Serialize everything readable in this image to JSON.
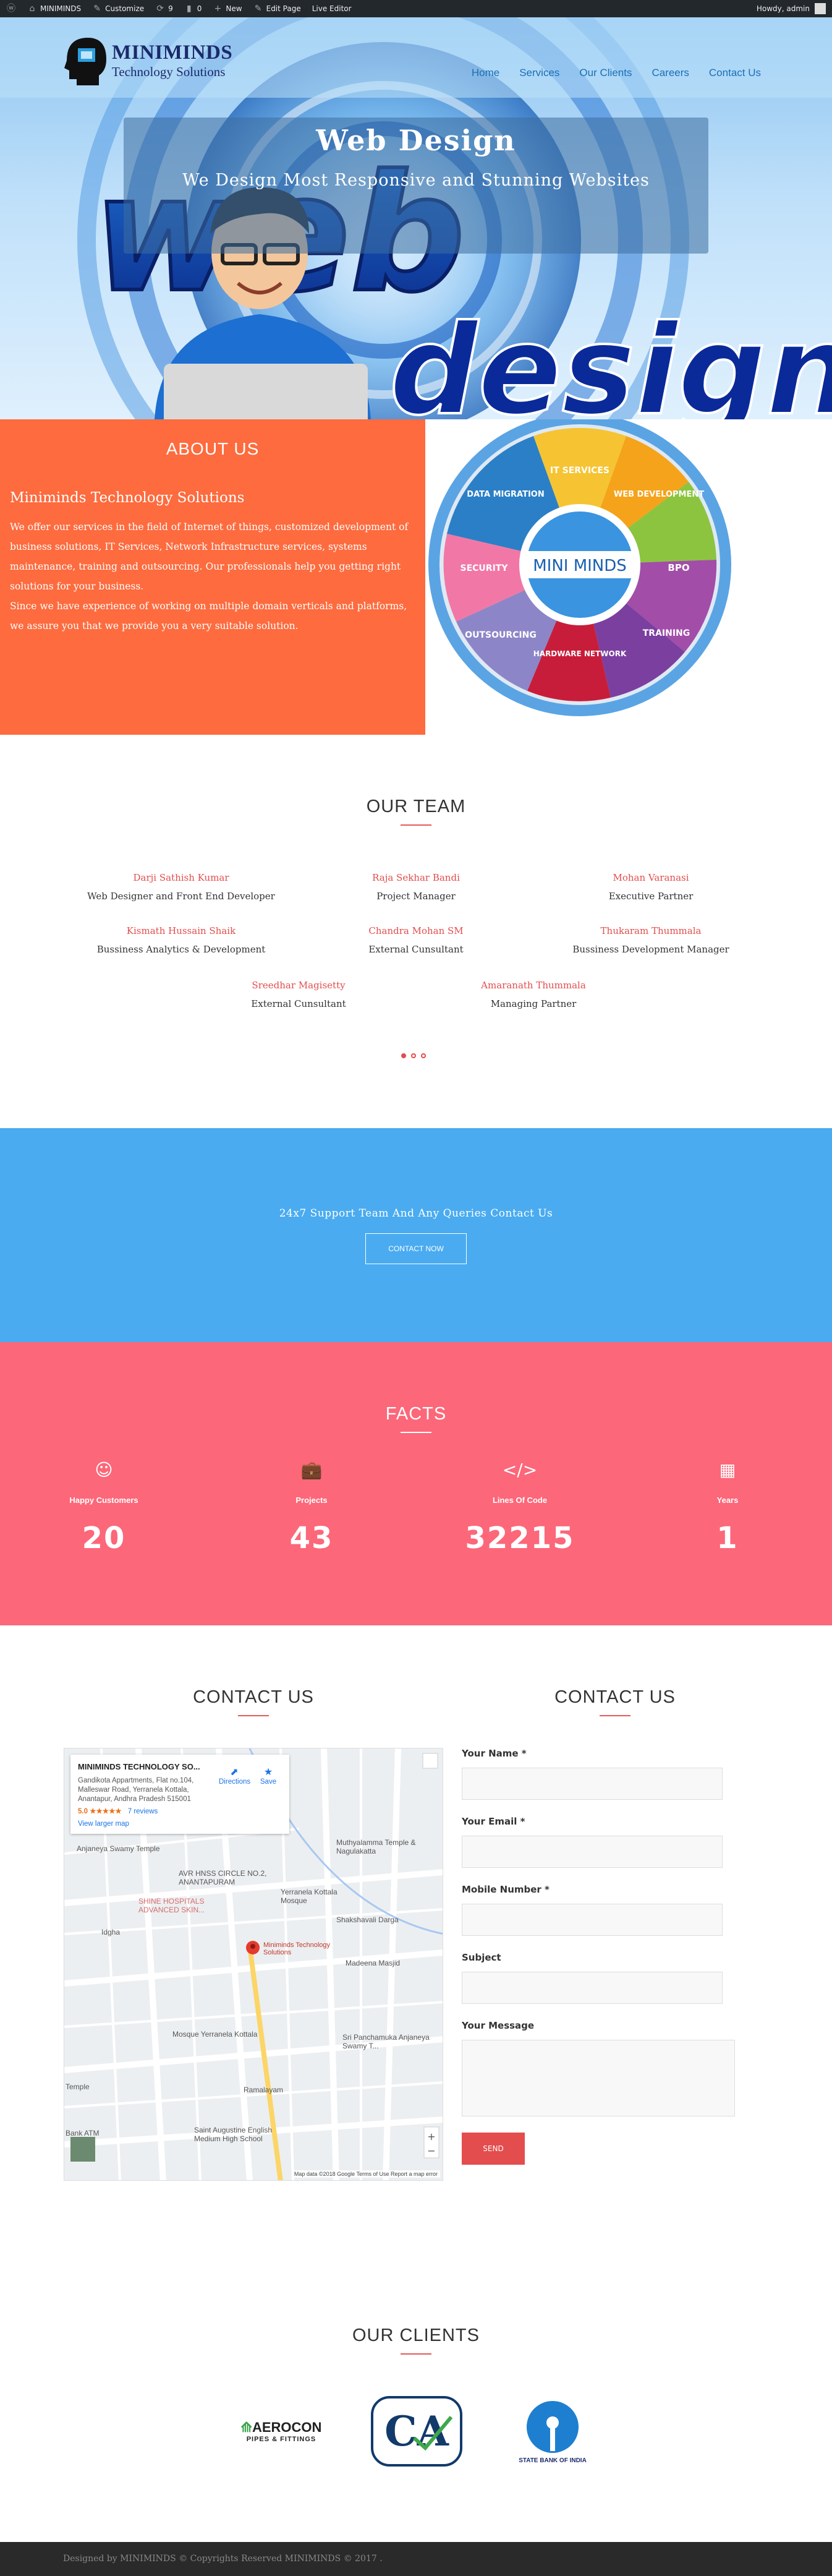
{
  "adminbar": {
    "site_name": "MINIMINDS",
    "customize": "Customize",
    "updates_count": "9",
    "comments_count": "0",
    "new_label": "New",
    "edit_page": "Edit Page",
    "live_editor": "Live Editor",
    "howdy": "Howdy, admin"
  },
  "header": {
    "logo_name": "MINIMINDS",
    "logo_sub": "Technology Solutions",
    "nav": [
      "Home",
      "Services",
      "Our Clients",
      "Careers",
      "Contact Us"
    ]
  },
  "hero": {
    "title": "Web Design",
    "subtitle": "We Design Most Responsive and Stunning Websites"
  },
  "about": {
    "heading": "ABOUT US",
    "company": "Miniminds Technology Solutions",
    "paragraph1": "We offer our services in the field of Internet of things, customized development of business solutions, IT Services, Network Infrastructure services, systems maintenance, training and outsourcing. Our professionals help you getting right solutions for your business.",
    "paragraph2": "Since we have experience of working on multiple domain verticals and platforms, we assure you that we provide you a very suitable solution.",
    "wheel_center": "MINI MINDS",
    "wheel_segments": [
      "IT SERVICES",
      "WEB DEVELOPMENT",
      "BPO",
      "TRAINING",
      "HARDWARE NETWORK",
      "OUTSOURCING",
      "SECURITY",
      "DATA MIGRATION"
    ]
  },
  "team": {
    "heading": "OUR TEAM",
    "members": [
      {
        "name": "Darji Sathish Kumar",
        "role": "Web Designer and Front End Developer"
      },
      {
        "name": "Raja Sekhar Bandi",
        "role": "Project Manager"
      },
      {
        "name": "Mohan Varanasi",
        "role": "Executive Partner"
      },
      {
        "name": "Kismath Hussain Shaik",
        "role": "Bussiness Analytics & Development"
      },
      {
        "name": "Chandra Mohan SM",
        "role": "External Cunsultant"
      },
      {
        "name": "Thukaram Thummala",
        "role": "Bussiness Development Manager"
      },
      {
        "name": "Sreedhar Magisetty",
        "role": "External Cunsultant"
      },
      {
        "name": "Amaranath Thummala",
        "role": "Managing Partner"
      }
    ]
  },
  "support": {
    "text": "24x7 Support Team And Any Queries Contact Us",
    "button": "CONTACT NOW"
  },
  "facts": {
    "heading": "FACTS",
    "items": [
      {
        "icon": "smile-icon",
        "label": "Happy Customers",
        "value": "20"
      },
      {
        "icon": "briefcase-icon",
        "label": "Projects",
        "value": "43"
      },
      {
        "icon": "code-icon",
        "label": "Lines Of Code",
        "value": "32215"
      },
      {
        "icon": "calendar-icon",
        "label": "Years",
        "value": "1"
      }
    ]
  },
  "contact": {
    "map_heading": "CONTACT US",
    "form_heading": "CONTACT US",
    "map": {
      "place_title": "MINIMINDS TECHNOLOGY SO...",
      "address": "Gandikota Appartments, Flat no.104, Malleswar Road, Yerranela Kottala, Anantapur, Andhra Pradesh 515001",
      "rating": "5.0 ★★★★★",
      "reviews": "7 reviews",
      "larger_map": "View larger map",
      "directions": "Directions",
      "save": "Save",
      "pin_label": "Miniminds Technology Solutions",
      "footer": "Map data ©2018 Google   Terms of Use   Report a map error",
      "labels": [
        "Anjaneya Swamy Temple",
        "AVR HNSS CIRCLE NO.2, ANANTAPURAM",
        "SHINE HOSPITALS ADVANCED SKIN...",
        "Idgha",
        "Mosque Yerranela Kottala",
        "Ramalayam",
        "Saint Augustine English Medium High School",
        "Shakshavali Darga",
        "Madeena Masjid",
        "Sri Panchamuka Anjaneya Swamy T...",
        "Muthyalamma Temple & Nagulakatta",
        "Yerranela Kottala Mosque",
        "Temple",
        "Bank ATM"
      ]
    },
    "form": {
      "name_label": "Your Name *",
      "email_label": "Your Email *",
      "mobile_label": "Mobile Number *",
      "subject_label": "Subject",
      "message_label": "Your Message",
      "send": "SEND"
    }
  },
  "clients": {
    "heading": "OUR CLIENTS",
    "items": [
      {
        "name": "AEROCON",
        "tagline": "PIPES & FITTINGS"
      },
      {
        "name": "CA",
        "tagline": ""
      },
      {
        "name": "STATE BANK OF INDIA",
        "tagline": ""
      }
    ]
  },
  "footer": {
    "text": "Designed by MINIMINDS © Copyrights Reserved MINIMINDS © 2017 ."
  },
  "colors": {
    "about_bg": "#fd6b3e",
    "support_bg": "#4aabf0",
    "facts_bg": "#fc6779",
    "accent": "#e34d4d",
    "nav_link": "#1a6fb5"
  }
}
